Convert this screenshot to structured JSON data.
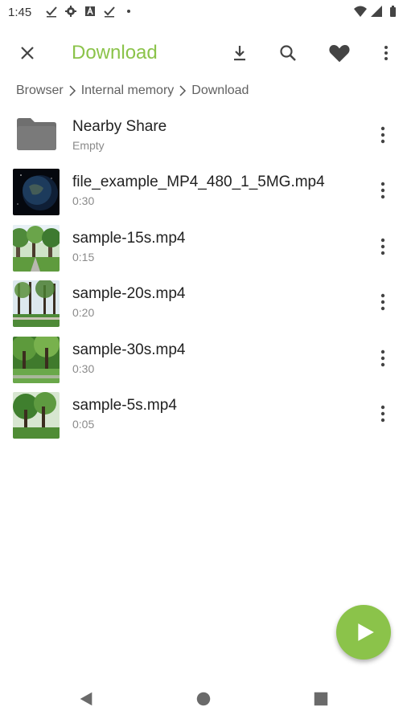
{
  "status_bar": {
    "time": "1:45",
    "left_icons": [
      "check-icon",
      "gear-icon",
      "a-box-icon",
      "check-icon",
      "dot-icon"
    ],
    "right_icons": [
      "wifi-icon",
      "signal-icon",
      "battery-icon"
    ]
  },
  "app_bar": {
    "title": "Download",
    "accent_color": "#8bc34a",
    "actions": [
      "close-icon",
      "download-icon",
      "search-icon",
      "heart-icon",
      "more-vert-icon"
    ]
  },
  "breadcrumb": [
    "Browser",
    "Internal memory",
    "Download"
  ],
  "files": [
    {
      "name": "Nearby Share",
      "sub": "Empty",
      "type": "folder"
    },
    {
      "name": "file_example_MP4_480_1_5MG.mp4",
      "sub": "0:30",
      "type": "video",
      "thumb": "earth"
    },
    {
      "name": "sample-15s.mp4",
      "sub": "0:15",
      "type": "video",
      "thumb": "park"
    },
    {
      "name": "sample-20s.mp4",
      "sub": "0:20",
      "type": "video",
      "thumb": "park"
    },
    {
      "name": "sample-30s.mp4",
      "sub": "0:30",
      "type": "video",
      "thumb": "park"
    },
    {
      "name": "sample-5s.mp4",
      "sub": "0:05",
      "type": "video",
      "thumb": "park"
    }
  ],
  "fab": {
    "icon": "play-icon",
    "color": "#8bc34a"
  },
  "nav_bar": [
    "back-icon",
    "home-icon",
    "recents-icon"
  ]
}
